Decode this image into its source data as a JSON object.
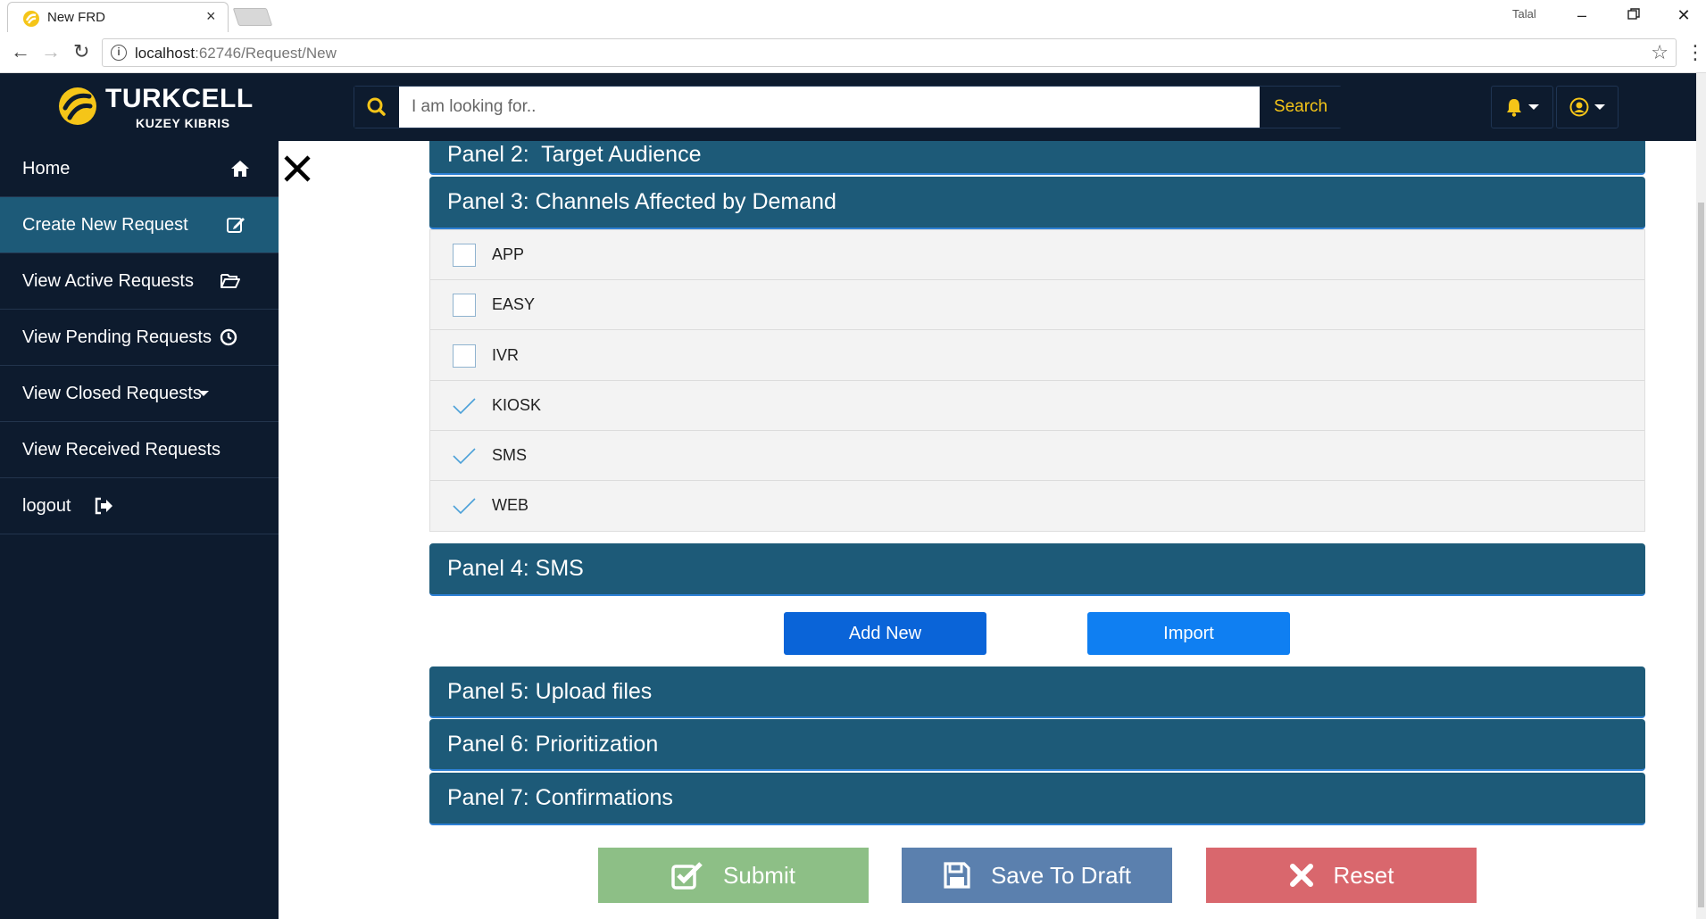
{
  "browser": {
    "tab_title": "New FRD",
    "tab_close": "×",
    "window_user": "Talal",
    "url_host": "localhost",
    "url_path": ":62746/Request/New"
  },
  "header": {
    "brand": "TURKCELL",
    "brand_sub": "KUZEY KIBRIS",
    "search_placeholder": "I am looking for..",
    "search_button": "Search",
    "icons": [
      "bell-icon",
      "user-circle-icon"
    ],
    "accent_color": "#f5c518"
  },
  "sidebar": {
    "items": [
      {
        "label": "Home",
        "icon": "home-icon"
      },
      {
        "label": "Create New Request",
        "icon": "edit-icon",
        "active": true
      },
      {
        "label": "View Active Requests",
        "icon": "folder-open-icon"
      },
      {
        "label": "View Pending Requests",
        "icon": "clock-icon"
      },
      {
        "label": "View Closed Requests",
        "icon": "caret-down-icon"
      },
      {
        "label": "View Received Requests"
      },
      {
        "label": "logout",
        "icon": "sign-out-icon"
      }
    ]
  },
  "panels": {
    "p2": "Panel 2:  Target Audience",
    "p3": "Panel 3: Channels Affected by Demand",
    "p4": "Panel 4: SMS",
    "p5": "Panel 5: Upload files",
    "p6": "Panel 6: Prioritization",
    "p7": "Panel 7: Confirmations"
  },
  "channels": [
    {
      "label": "APP",
      "checked": false
    },
    {
      "label": "EASY",
      "checked": false
    },
    {
      "label": "IVR",
      "checked": false
    },
    {
      "label": "KIOSK",
      "checked": true
    },
    {
      "label": "SMS",
      "checked": true
    },
    {
      "label": "WEB",
      "checked": true
    }
  ],
  "sms_actions": {
    "add_new": "Add New",
    "import": "Import"
  },
  "footer_actions": {
    "submit": "Submit",
    "save_draft": "Save To Draft",
    "reset": "Reset"
  },
  "colors": {
    "panel": "#1d5a78",
    "navy": "#0d1b2e",
    "submit": "#8dbf86",
    "draft": "#5b80ae",
    "reset": "#d9676d"
  }
}
